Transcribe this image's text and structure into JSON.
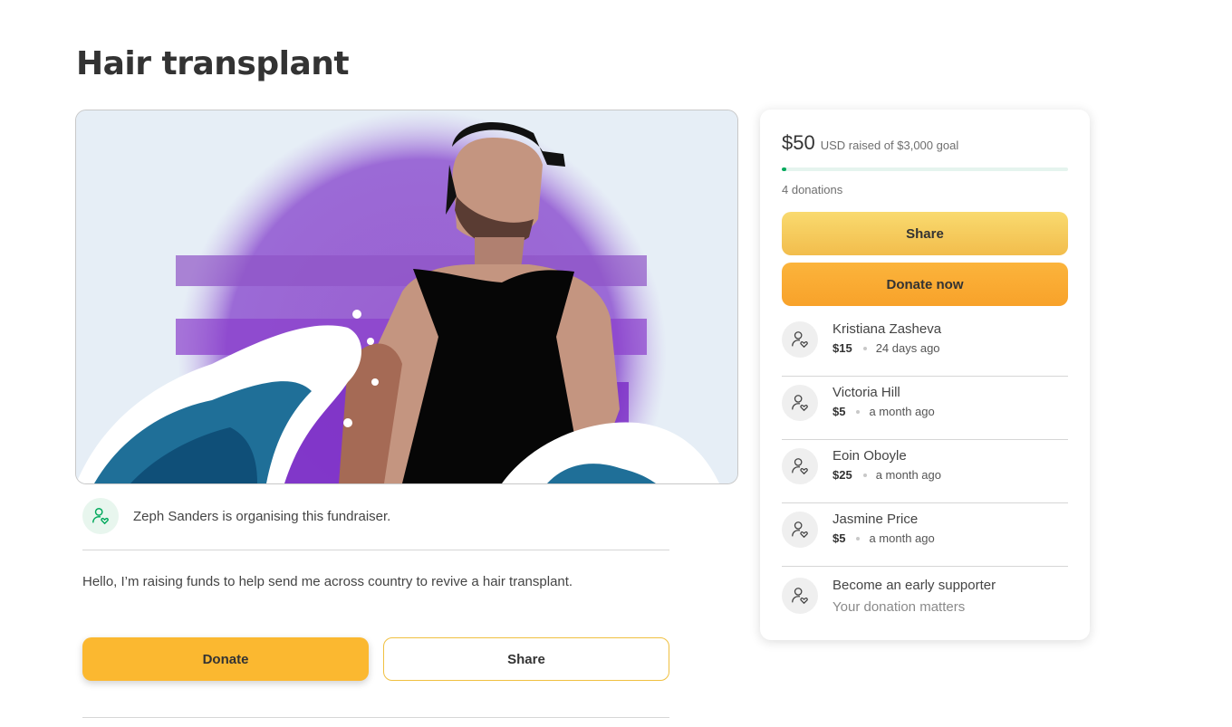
{
  "page": {
    "title": "Hair transplant"
  },
  "organiser": {
    "text": "Zeph Sanders is organising this fundraiser.",
    "icon": "user-heart-icon"
  },
  "description": "Hello, I’m raising funds to help send me across country to revive a hair transplant.",
  "actions": {
    "donate_label": "Donate",
    "share_label": "Share"
  },
  "summary": {
    "raised_amount": "$50",
    "raised_goal_text": "USD raised of $3,000 goal",
    "progress_fraction": 0.0167,
    "donation_count": "4 donations",
    "share_label": "Share",
    "donate_label": "Donate now"
  },
  "donations": [
    {
      "name": "Kristiana Zasheva",
      "amount": "$15",
      "when": "24 days ago"
    },
    {
      "name": "Victoria Hill",
      "amount": "$5",
      "when": "a month ago"
    },
    {
      "name": "Eoin Oboyle",
      "amount": "$25",
      "when": "a month ago"
    },
    {
      "name": "Jasmine Price",
      "amount": "$5",
      "when": "a month ago"
    }
  ],
  "early_supporter": {
    "title": "Become an early supporter",
    "subtitle": "Your donation matters"
  },
  "colors": {
    "accent_green": "#02a95c",
    "donate_yellow": "#fbb830",
    "share_yellow": "#f2bd4c"
  }
}
